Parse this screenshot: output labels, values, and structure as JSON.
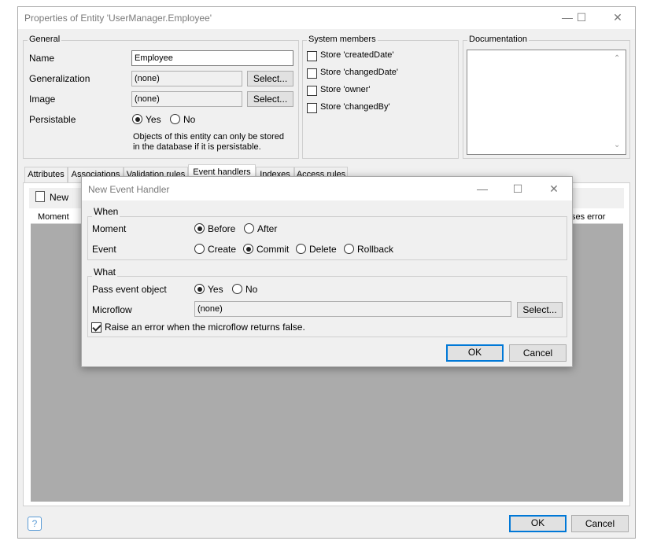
{
  "window": {
    "title": "Properties of Entity 'UserManager.Employee'"
  },
  "general": {
    "legend": "General",
    "name_label": "Name",
    "name_value": "Employee",
    "generalization_label": "Generalization",
    "generalization_value": "(none)",
    "image_label": "Image",
    "image_value": "(none)",
    "select_label": "Select...",
    "persistable_label": "Persistable",
    "yes": "Yes",
    "no": "No",
    "note_line1": "Objects of this entity can only be stored",
    "note_line2": "in the database if it is persistable."
  },
  "system_members": {
    "legend": "System members",
    "items": [
      {
        "label": "Store 'createdDate'",
        "checked": false
      },
      {
        "label": "Store 'changedDate'",
        "checked": false
      },
      {
        "label": "Store 'owner'",
        "checked": false
      },
      {
        "label": "Store 'changedBy'",
        "checked": false
      }
    ]
  },
  "documentation": {
    "legend": "Documentation",
    "value": ""
  },
  "tabs": [
    "Attributes",
    "Associations",
    "Validation rules",
    "Event handlers",
    "Indexes",
    "Access rules"
  ],
  "active_tab": "Event handlers",
  "toolbar": {
    "new_label": "New"
  },
  "grid": {
    "columns": [
      "Moment",
      "ses error"
    ]
  },
  "footer": {
    "ok": "OK",
    "cancel": "Cancel",
    "help_icon": "question-icon"
  },
  "dialog": {
    "title": "New Event Handler",
    "when": {
      "legend": "When",
      "moment_label": "Moment",
      "moment_options": [
        "Before",
        "After"
      ],
      "moment_selected": "Before",
      "event_label": "Event",
      "event_options": [
        "Create",
        "Commit",
        "Delete",
        "Rollback"
      ],
      "event_selected": "Commit"
    },
    "what": {
      "legend": "What",
      "pass_label": "Pass event object",
      "pass_yes": "Yes",
      "pass_no": "No",
      "microflow_label": "Microflow",
      "microflow_value": "(none)",
      "select_label": "Select...",
      "raise_label": "Raise an error when the microflow returns false.",
      "raise_checked": true
    },
    "ok": "OK",
    "cancel": "Cancel"
  },
  "colors": {
    "accent": "#0078d7",
    "grid_bg": "#ababab",
    "window_bg": "#f0f0f0"
  }
}
